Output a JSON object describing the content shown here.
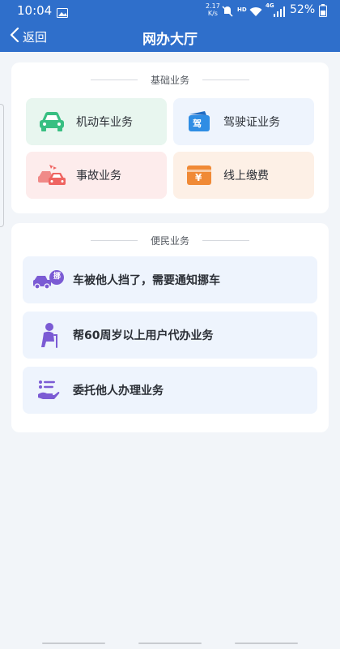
{
  "status_bar": {
    "time": "10:04",
    "network_speed_value": "2.17",
    "network_speed_unit": "K/s",
    "hd_label": "HD",
    "network_type": "4G",
    "battery": "52%"
  },
  "header": {
    "back_label": "返回",
    "title": "网办大厅"
  },
  "basic_services": {
    "title": "基础业务",
    "tiles": [
      {
        "label": "机动车业务",
        "icon": "car-icon",
        "color": "#38bf82"
      },
      {
        "label": "驾驶证业务",
        "icon": "license-icon",
        "icon_text": "驾",
        "color": "#2f8de4"
      },
      {
        "label": "事故业务",
        "icon": "accident-icon",
        "color": "#ef6461"
      },
      {
        "label": "线上缴费",
        "icon": "payment-icon",
        "icon_text": "¥",
        "color": "#f08a36"
      }
    ]
  },
  "convenience_services": {
    "title": "便民业务",
    "rows": [
      {
        "label": "车被他人挡了，需要通知挪车",
        "icon": "move-car-icon",
        "icon_text": "挪",
        "color": "#7b5bd4"
      },
      {
        "label": "帮60周岁以上用户代办业务",
        "icon": "elderly-icon",
        "color": "#7b5bd4"
      },
      {
        "label": "委托他人办理业务",
        "icon": "delegate-icon",
        "color": "#7b5bd4"
      }
    ]
  },
  "colors": {
    "header_bg": "#2f6fcb",
    "page_bg": "#f2f5f9"
  }
}
